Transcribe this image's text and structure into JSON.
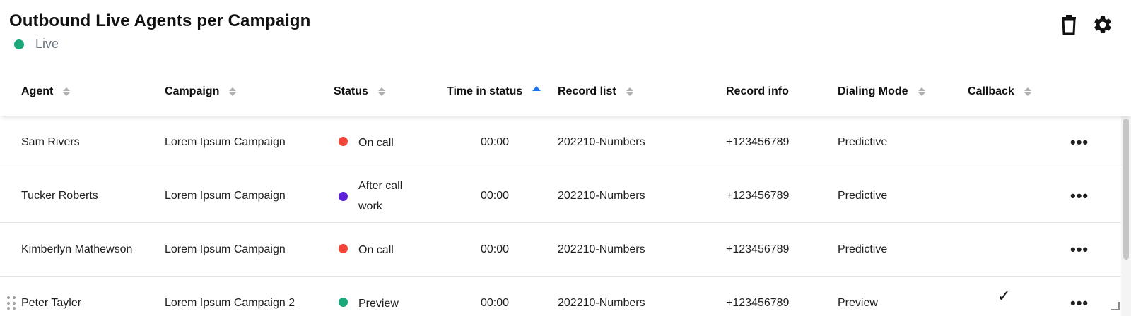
{
  "widget": {
    "title": "Outbound Live Agents per Campaign",
    "live_label": "Live",
    "live_color": "#1aa87a",
    "toolbar": {
      "delete_icon": "trash-icon",
      "settings_icon": "gear-icon"
    }
  },
  "table": {
    "columns": [
      {
        "label": "Agent",
        "sort": "none"
      },
      {
        "label": "Campaign",
        "sort": "none"
      },
      {
        "label": "Status",
        "sort": "none"
      },
      {
        "label": "Time in status",
        "sort": "ascending"
      },
      {
        "label": "Record list",
        "sort": "none"
      },
      {
        "label": "Record info",
        "sort": "unsortable"
      },
      {
        "label": "Dialing Mode",
        "sort": "none"
      },
      {
        "label": "Callback",
        "sort": "none"
      }
    ],
    "sort_active_color": "#1a73e8",
    "rows": [
      {
        "agent": "Sam Rivers",
        "campaign": "Lorem Ipsum Campaign",
        "status": "On call",
        "status_color": "#f04438",
        "time": "00:00",
        "record_list": "202210-Numbers",
        "record_info": "+123456789",
        "dialing_mode": "Predictive",
        "callback": "",
        "more": "•••"
      },
      {
        "agent": "Tucker Roberts",
        "campaign": "Lorem Ipsum Campaign",
        "status": "After call work",
        "status_color": "#5b21d6",
        "time": "00:00",
        "record_list": "202210-Numbers",
        "record_info": "+123456789",
        "dialing_mode": "Predictive",
        "callback": "",
        "more": "•••"
      },
      {
        "agent": "Kimberlyn Mathewson",
        "campaign": "Lorem Ipsum Campaign",
        "status": "On call",
        "status_color": "#f04438",
        "time": "00:00",
        "record_list": "202210-Numbers",
        "record_info": "+123456789",
        "dialing_mode": "Predictive",
        "callback": "",
        "more": "•••"
      },
      {
        "agent": "Peter Tayler",
        "campaign": "Lorem Ipsum Campaign 2",
        "status": "Preview",
        "status_color": "#1aa87a",
        "time": "00:00",
        "record_list": "202210-Numbers",
        "record_info": "+123456789",
        "dialing_mode": "Preview",
        "callback": "✓",
        "more": "•••"
      }
    ]
  }
}
